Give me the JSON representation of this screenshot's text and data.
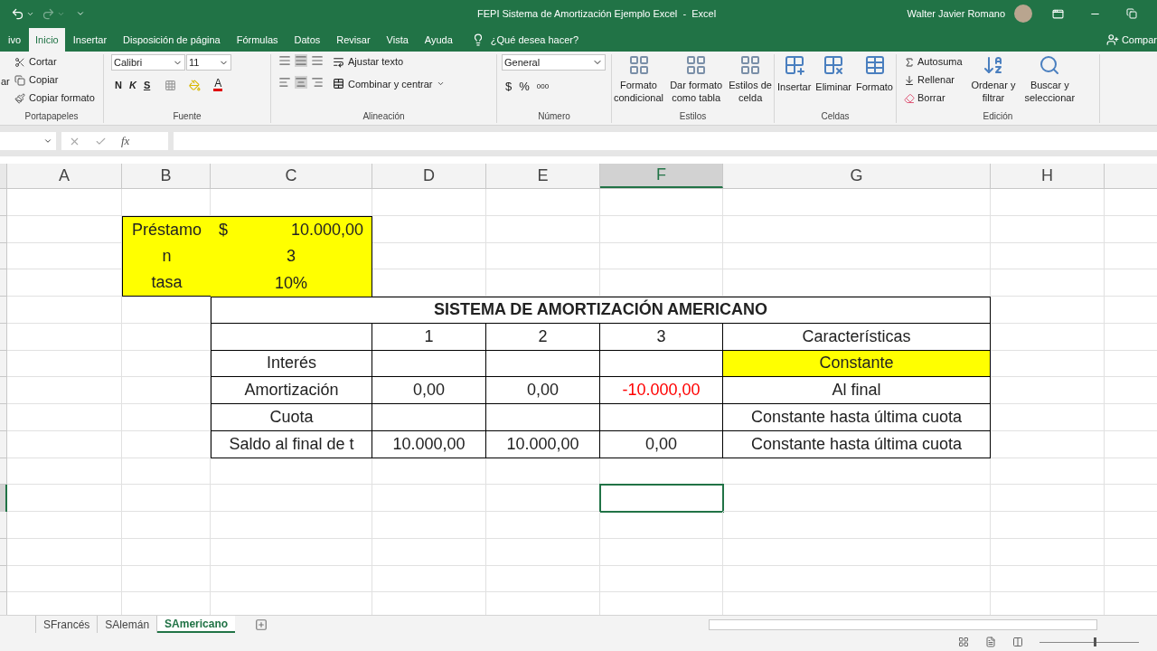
{
  "title_bar": {
    "title": "FEPI Sistema de Amortización Ejemplo Excel  -  Excel",
    "user": "Walter Javier Romano"
  },
  "ribbon_tabs": [
    {
      "label": "ivo",
      "selected": false
    },
    {
      "label": "Inicio",
      "selected": true
    },
    {
      "label": "Insertar",
      "selected": false
    },
    {
      "label": "Disposición de página",
      "selected": false
    },
    {
      "label": "Fórmulas",
      "selected": false
    },
    {
      "label": "Datos",
      "selected": false
    },
    {
      "label": "Revisar",
      "selected": false
    },
    {
      "label": "Vista",
      "selected": false
    },
    {
      "label": "Ayuda",
      "selected": false
    }
  ],
  "tell_me": "¿Qué desea hacer?",
  "share": "Compar",
  "ribbon": {
    "clipboard": {
      "paste": "ar",
      "items": [
        "Cortar",
        "Copiar",
        "Copiar formato"
      ],
      "label": "Portapapeles"
    },
    "font": {
      "family": "Calibri",
      "size": "11",
      "styles": [
        "N",
        "K",
        "S"
      ],
      "color_glyph": "A",
      "label": "Fuente"
    },
    "alignment": {
      "wrap": "Ajustar texto",
      "merge": "Combinar y centrar",
      "label": "Alineación"
    },
    "number": {
      "format": "General",
      "symbols": [
        "$",
        "%",
        "000"
      ],
      "label": "Número"
    },
    "styles": {
      "items": [
        [
          "Formato",
          "condicional"
        ],
        [
          "Dar formato",
          "como tabla"
        ],
        [
          "Estilos de",
          "celda"
        ]
      ],
      "label": "Estilos"
    },
    "cells": {
      "items": [
        "Insertar",
        "Eliminar",
        "Formato"
      ],
      "label": "Celdas"
    },
    "editing": {
      "small": [
        "Autosuma",
        "Rellenar",
        "Borrar"
      ],
      "large": [
        [
          "Ordenar y",
          "filtrar"
        ],
        [
          "Buscar y",
          "seleccionar"
        ]
      ],
      "label": "Edición"
    }
  },
  "formula_bar": {
    "fx": "fx"
  },
  "sheet": {
    "columns": [
      {
        "label": "A",
        "selected": false
      },
      {
        "label": "B",
        "selected": false
      },
      {
        "label": "C",
        "selected": false
      },
      {
        "label": "D",
        "selected": false
      },
      {
        "label": "E",
        "selected": false
      },
      {
        "label": "F",
        "selected": true
      },
      {
        "label": "G",
        "selected": false
      },
      {
        "label": "H",
        "selected": false
      }
    ],
    "rows": [
      {
        "kind": "plain",
        "cells": []
      },
      {
        "kind": "plain",
        "cells": [
          "",
          {
            "text": "Préstamo",
            "highlighted": true
          },
          {
            "currency": "$",
            "text": "10.000,00",
            "highlighted": true
          }
        ]
      },
      {
        "kind": "plain",
        "cells": [
          "",
          {
            "text": "n",
            "highlighted": true
          },
          {
            "text": "3",
            "highlighted": true
          }
        ]
      },
      {
        "kind": "plain",
        "cells": [
          "",
          {
            "text": "tasa",
            "highlighted": true
          },
          {
            "text": "10%",
            "highlighted": true
          }
        ]
      },
      {
        "kind": "title",
        "title": "SISTEMA DE AMORTIZACIÓN AMERICANO"
      },
      {
        "kind": "table",
        "cells": [
          "",
          "",
          "",
          "1",
          "2",
          "3",
          "Características"
        ]
      },
      {
        "kind": "table",
        "cells": [
          "",
          "",
          "Interés",
          "",
          "",
          "",
          {
            "text": "Constante",
            "highlighted": true
          }
        ]
      },
      {
        "kind": "table",
        "cells": [
          "",
          "",
          "Amortización",
          "0,00",
          "0,00",
          {
            "text": "-10.000,00",
            "negative": true
          },
          "Al final"
        ]
      },
      {
        "kind": "table",
        "cells": [
          "",
          "",
          "Cuota",
          "",
          "",
          "",
          "Constante hasta última cuota"
        ]
      },
      {
        "kind": "table",
        "cells": [
          "",
          "",
          "Saldo al final de t",
          "10.000,00",
          "10.000,00",
          "0,00",
          "Constante hasta última cuota"
        ]
      },
      {
        "kind": "plain",
        "cells": []
      },
      {
        "kind": "plain",
        "cells": [
          "",
          "",
          "",
          "",
          "",
          {
            "selected": true
          }
        ]
      }
    ]
  },
  "sheet_tabs": [
    {
      "label": "SFrancés",
      "selected": false
    },
    {
      "label": "SAlemán",
      "selected": false
    },
    {
      "label": "SAmericano",
      "selected": true
    }
  ],
  "zoom": {
    "level": 0.55
  }
}
